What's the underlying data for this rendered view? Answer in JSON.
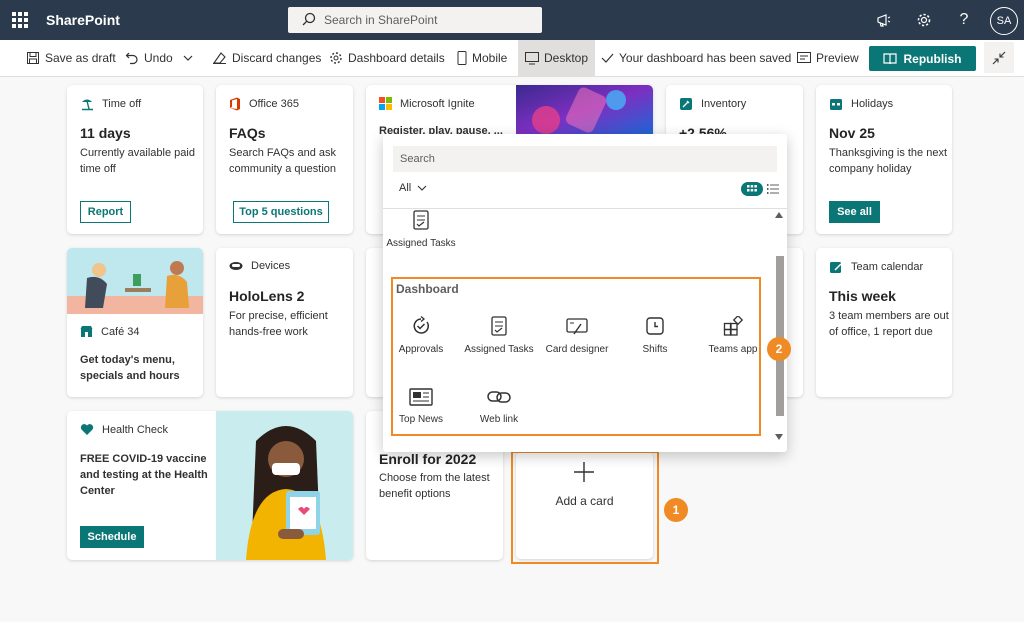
{
  "suitebar": {
    "brand": "SharePoint",
    "search_placeholder": "Search in SharePoint",
    "avatar_initials": "SA"
  },
  "commandbar": {
    "save_draft": "Save as draft",
    "undo": "Undo",
    "discard": "Discard changes",
    "details": "Dashboard details",
    "mobile": "Mobile",
    "desktop": "Desktop",
    "saved_status": "Your dashboard has been saved",
    "preview": "Preview",
    "republish": "Republish"
  },
  "cards": {
    "timeoff": {
      "header": "Time off",
      "title": "11 days",
      "body": "Currently available paid time off",
      "button": "Report"
    },
    "office": {
      "header": "Office 365",
      "title": "FAQs",
      "body": "Search FAQs and ask community a question",
      "button": "Top 5 questions"
    },
    "ignite": {
      "header": "Microsoft Ignite",
      "body": "Register, play, pause, ..."
    },
    "inventory": {
      "header": "Inventory",
      "title": "+2.56%"
    },
    "holidays": {
      "header": "Holidays",
      "title": "Nov 25",
      "body": "Thanksgiving is the next company holiday",
      "button": "See all"
    },
    "cafe": {
      "header": "Café 34",
      "body": "Get today's menu, specials and hours"
    },
    "devices": {
      "header": "Devices",
      "title": "HoloLens 2",
      "body": "For precise, efficient hands-free work"
    },
    "calendar": {
      "header": "Team calendar",
      "title": "This week",
      "body": "3 team members are out of office, 1 report due"
    },
    "health": {
      "header": "Health Check",
      "body": "FREE COVID-19 vaccine and testing at the Health Center",
      "button": "Schedule"
    },
    "enroll": {
      "title": "Enroll for 2022",
      "body": "Choose from the latest benefit options"
    },
    "add": {
      "label": "Add a card"
    }
  },
  "flyout": {
    "search_placeholder": "Search",
    "filter": "All",
    "top_item": "Assigned Tasks",
    "section": "Dashboard",
    "items": [
      "Approvals",
      "Assigned Tasks",
      "Card designer",
      "Shifts",
      "Teams app",
      "Top News",
      "Web link"
    ]
  },
  "callouts": [
    "1",
    "2"
  ],
  "colors": {
    "suitebar": "#2b3a4c",
    "accent": "#0b7676",
    "highlight": "#f08a24"
  }
}
